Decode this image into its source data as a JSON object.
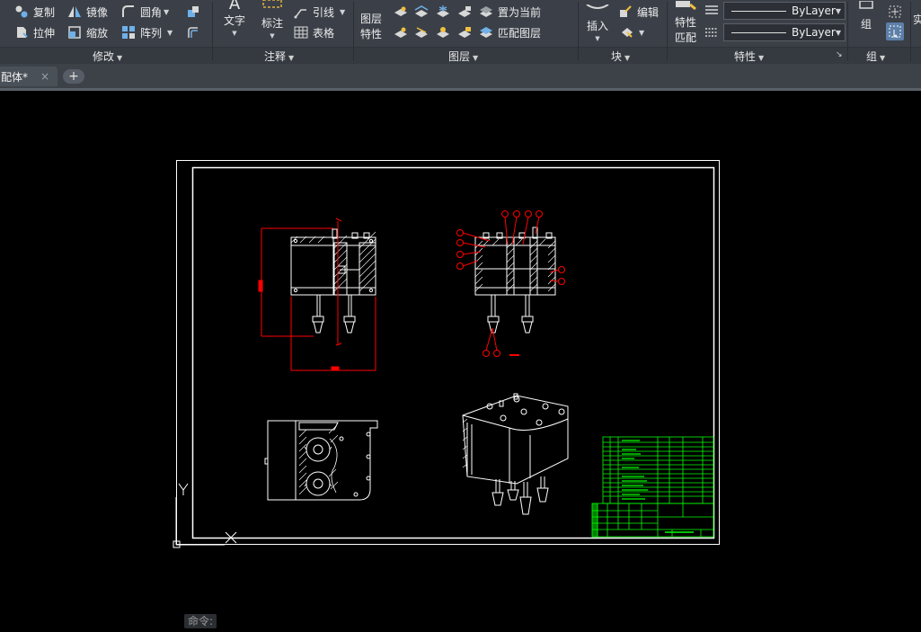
{
  "ribbon": {
    "modify": {
      "copy": "复制",
      "mirror": "镜像",
      "fillet": "圆角",
      "stretch": "拉伸",
      "scale": "缩放",
      "array": "阵列",
      "title": "修改"
    },
    "annotation": {
      "text": "文字",
      "dimension": "标注",
      "leader": "引线",
      "table": "表格",
      "title": "注释"
    },
    "layers": {
      "layer_properties_1": "图层",
      "layer_properties_2": "特性",
      "set_current": "置为当前",
      "match_layer": "匹配图层",
      "title": "图层"
    },
    "block": {
      "insert": "插入",
      "edit": "编辑",
      "title": "块"
    },
    "properties": {
      "match_1": "特性",
      "match_2": "匹配",
      "color": "ByLayer",
      "linetype": "ByLayer",
      "title": "特性"
    },
    "groups": {
      "group": "组",
      "title": "组"
    },
    "cut_label": "实"
  },
  "tabs": {
    "active_label": "配体*",
    "close": "×",
    "new": "+"
  },
  "command": {
    "prompt": "命令:"
  },
  "colors": {
    "ribbon_bg": "#3b4048",
    "model_bg": "#000000",
    "drawing_white": "#ffffff",
    "dimension_red": "#ff0000",
    "titleblock_green": "#00ff00"
  }
}
